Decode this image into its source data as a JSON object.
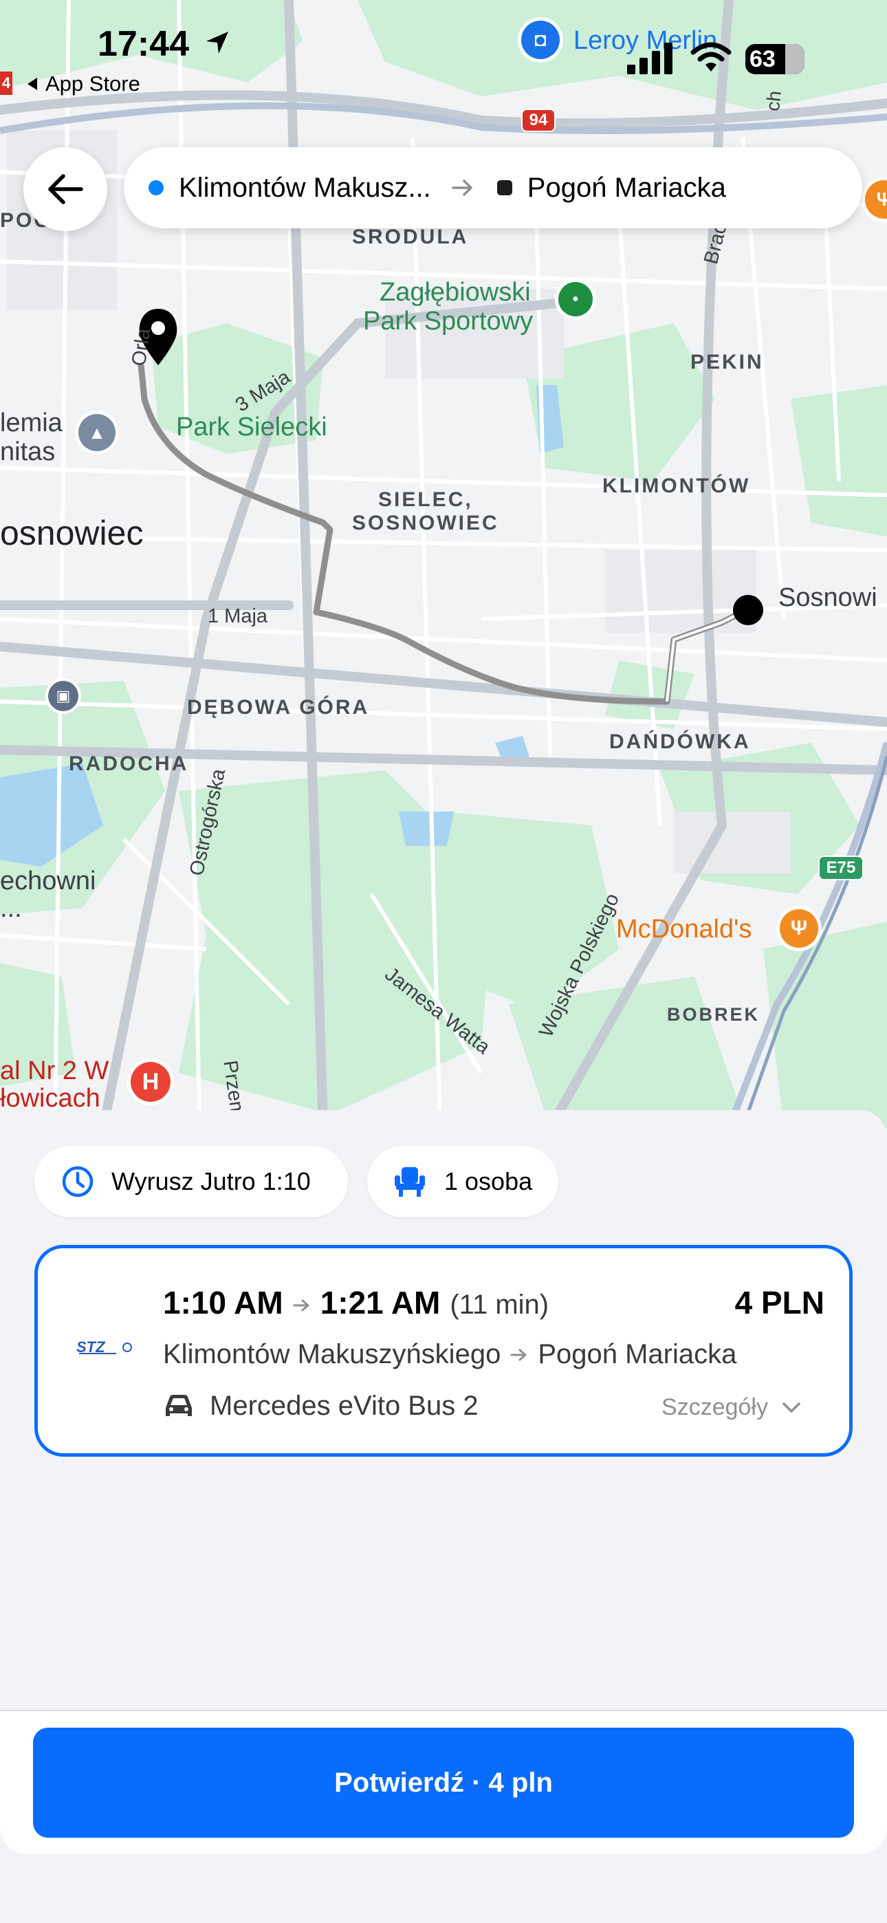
{
  "status_bar": {
    "time": "17:44",
    "back_app": "App Store",
    "battery": "63"
  },
  "route": {
    "from": "Klimontów Makusz...",
    "to": "Pogoń Mariacka"
  },
  "map": {
    "labels": {
      "pogon": "POGOŃ",
      "srodula": "SRODULA",
      "zaglebiowski1": "Zagłębiowski",
      "zaglebiowski2": "Park Sportowy",
      "pekin": "PEKIN",
      "braci": "Braci Mierc",
      "orla": "Orla",
      "maja3": "3 Maja",
      "akademia1": "lemia",
      "akademia2": "nitas",
      "park_sielecki": "Park Sielecki",
      "sielec1": "SIELEC,",
      "sielec2": "SOSNOWIEC",
      "klimontow": "KLIMONTÓW",
      "sosnowiec_city": "osnowiec",
      "sosnowi_right": "Sosnowi",
      "maja1": "1 Maja",
      "debowa": "DĘBOWA GÓRA",
      "dandowka": "DAŃDÓWKA",
      "radocha": "RADOCHA",
      "ostrogorska": "Ostrogórska",
      "wojska": "Wojska Polskiego",
      "e75": "E75",
      "mcdonalds": "McDonald's",
      "jamesa": "Jamesa Watta",
      "bobrek": "BOBREK",
      "echowni": "echowni",
      "dots": "...",
      "szpital1": "al Nr 2 W",
      "szpital2": "łowicach",
      "przem": "Przem",
      "leroy": "Leroy Merlin",
      "road94": "94",
      "roadcut": "4"
    }
  },
  "chips": {
    "depart": "Wyrusz Jutro 1:10",
    "passengers": "1 osoba"
  },
  "trip": {
    "depart_time": "1:10 AM",
    "arrive_time": "1:21 AM",
    "duration": "(11 min)",
    "price": "4 PLN",
    "from_stop": "Klimontów Makuszyńskiego",
    "to_stop": "Pogoń Mariacka",
    "vehicle": "Mercedes eVito Bus 2",
    "details": "Szczegóły",
    "logo_text": "STZ"
  },
  "confirm_label": "Potwierdź · 4 pln",
  "colors": {
    "accent": "#0a6cff",
    "route": "#8f8f8f",
    "park": "#c7ecd2"
  }
}
